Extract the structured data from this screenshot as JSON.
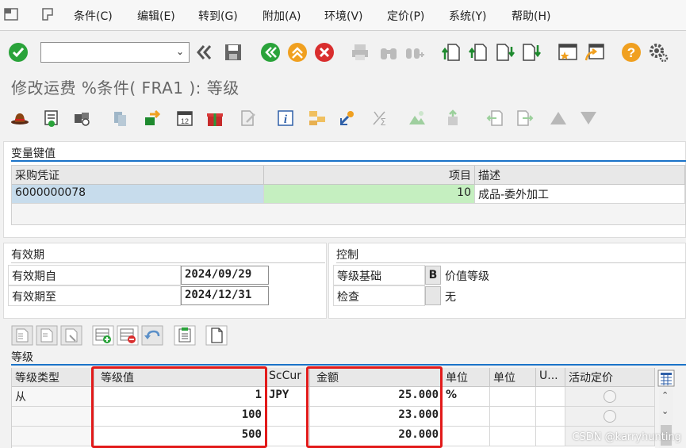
{
  "menu": {
    "items": [
      "条件(C)",
      "编辑(E)",
      "转到(G)",
      "附加(A)",
      "环境(V)",
      "定价(P)",
      "系统(Y)",
      "帮助(H)"
    ]
  },
  "toolbar": {
    "command_field_value": ""
  },
  "title": "修改运费 %条件( FRA1 ): 等级",
  "variable_key": {
    "group_title": "变量键值",
    "headers": [
      "采购凭证",
      "项目",
      "描述"
    ],
    "row": {
      "doc": "6000000078",
      "item": "10",
      "desc": "成品-委外加工"
    }
  },
  "validity": {
    "group_title": "有效期",
    "from_label": "有效期自",
    "from_value": "2024/09/29",
    "to_label": "有效期至",
    "to_value": "2024/12/31"
  },
  "control": {
    "group_title": "控制",
    "basis_label": "等级基础",
    "basis_code": "B",
    "basis_text": "价值等级",
    "check_label": "检查",
    "check_code": "",
    "check_text": "无"
  },
  "scales": {
    "group_title": "等级",
    "headers": [
      "等级类型",
      "等级值",
      "ScCur",
      "金额",
      "单位",
      "单位",
      "U...",
      "活动定价"
    ],
    "rows": [
      {
        "type": "从",
        "value": "1",
        "cur": "JPY",
        "amount": "25.000",
        "unit": "%"
      },
      {
        "type": "",
        "value": "100",
        "cur": "",
        "amount": "23.000",
        "unit": ""
      },
      {
        "type": "",
        "value": "500",
        "cur": "",
        "amount": "20.000",
        "unit": ""
      }
    ]
  },
  "watermark": "CSDN @karryhunting",
  "colors": {
    "highlight_red": "#e21a1a",
    "selected_row_blue": "#c7dcec",
    "item_green": "#c5efc0"
  }
}
